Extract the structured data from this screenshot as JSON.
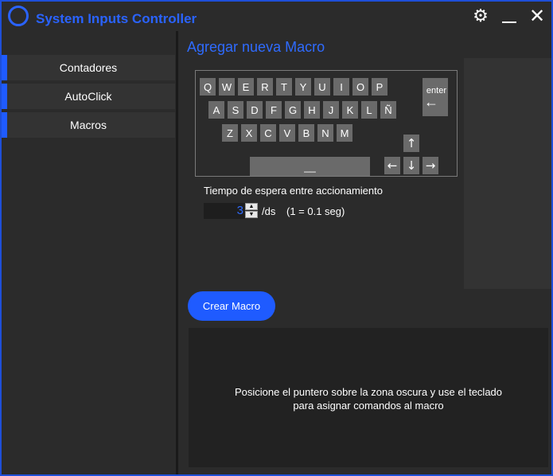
{
  "app": {
    "title": "System Inputs Controller"
  },
  "titlebar": {
    "settings_icon": "gear-icon",
    "minimize_icon": "minimize-icon",
    "close_icon": "close-icon"
  },
  "sidebar": {
    "items": [
      {
        "label": "Contadores"
      },
      {
        "label": "AutoClick"
      },
      {
        "label": "Macros"
      }
    ]
  },
  "main": {
    "title": "Agregar nueva Macro",
    "keyboard": {
      "row1": [
        "Q",
        "W",
        "E",
        "R",
        "T",
        "Y",
        "U",
        "I",
        "O",
        "P"
      ],
      "row2": [
        "A",
        "S",
        "D",
        "F",
        "G",
        "H",
        "J",
        "K",
        "L",
        "Ñ"
      ],
      "row3": [
        "Z",
        "X",
        "C",
        "V",
        "B",
        "N",
        "M"
      ],
      "enter_label": "enter",
      "enter_arrow": "←",
      "space_label": "__",
      "arrows": {
        "up": "↑",
        "left": "←",
        "down": "↓",
        "right": "→"
      }
    },
    "delay": {
      "label": "Tiempo de espera entre accionamiento",
      "value": "3",
      "unit": "/ds",
      "hint": "(1 = 0.1 seg)"
    },
    "create_button": "Crear Macro",
    "capture_zone": {
      "line1": "Posicione el puntero sobre la zona oscura y use el teclado",
      "line2": "para asignar comandos al macro"
    }
  },
  "colors": {
    "accent": "#1f5bff",
    "title_blue": "#2a63ff",
    "background": "#2b2b2b"
  }
}
